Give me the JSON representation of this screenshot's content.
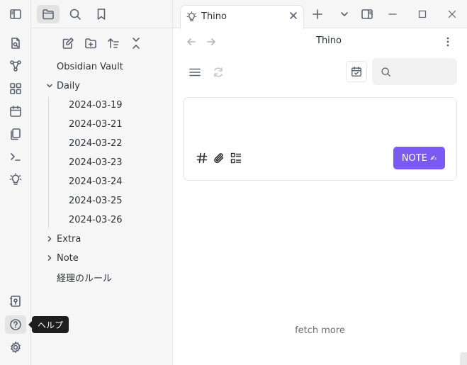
{
  "ribbon": {
    "items": [
      {
        "icon": "open-quick-switcher-icon"
      },
      {
        "icon": "graph-view-icon"
      },
      {
        "icon": "canvas-icon"
      },
      {
        "icon": "daily-note-calendar-icon"
      },
      {
        "icon": "templates-icon"
      },
      {
        "icon": "command-palette-icon"
      },
      {
        "icon": "thino-lightbulb-icon"
      }
    ],
    "bottom": [
      {
        "icon": "vault-switcher-icon"
      },
      {
        "icon": "help-icon"
      },
      {
        "icon": "settings-gear-icon"
      }
    ],
    "tooltip": "ヘルプ"
  },
  "left_tabs": [
    {
      "icon": "sidebar-toggle-icon"
    },
    {
      "icon": "files-folder-icon",
      "active": true
    },
    {
      "icon": "search-icon"
    },
    {
      "icon": "bookmarks-icon"
    }
  ],
  "nav_actions": [
    {
      "icon": "new-note-icon"
    },
    {
      "icon": "new-folder-icon"
    },
    {
      "icon": "sort-icon"
    },
    {
      "icon": "collapse-all-icon"
    }
  ],
  "file_tree": {
    "vault_name": "Obsidian Vault",
    "folders": [
      {
        "name": "Daily",
        "expanded": true,
        "files": [
          "2024-03-19",
          "2024-03-21",
          "2024-03-22",
          "2024-03-23",
          "2024-03-24",
          "2024-03-25",
          "2024-03-26"
        ]
      },
      {
        "name": "Extra",
        "expanded": false
      },
      {
        "name": "Note",
        "expanded": false
      }
    ],
    "root_files": [
      "経理のルール"
    ]
  },
  "tabs": [
    {
      "label": "Thino",
      "icon": "lightbulb-icon",
      "active": true
    }
  ],
  "view": {
    "title": "Thino",
    "note_button": "NOTE",
    "note_button_icon": "✍",
    "fetch_more": "fetch more"
  },
  "colors": {
    "accent": "#7a5af0",
    "sidebar_bg": "#f6f6f6"
  }
}
